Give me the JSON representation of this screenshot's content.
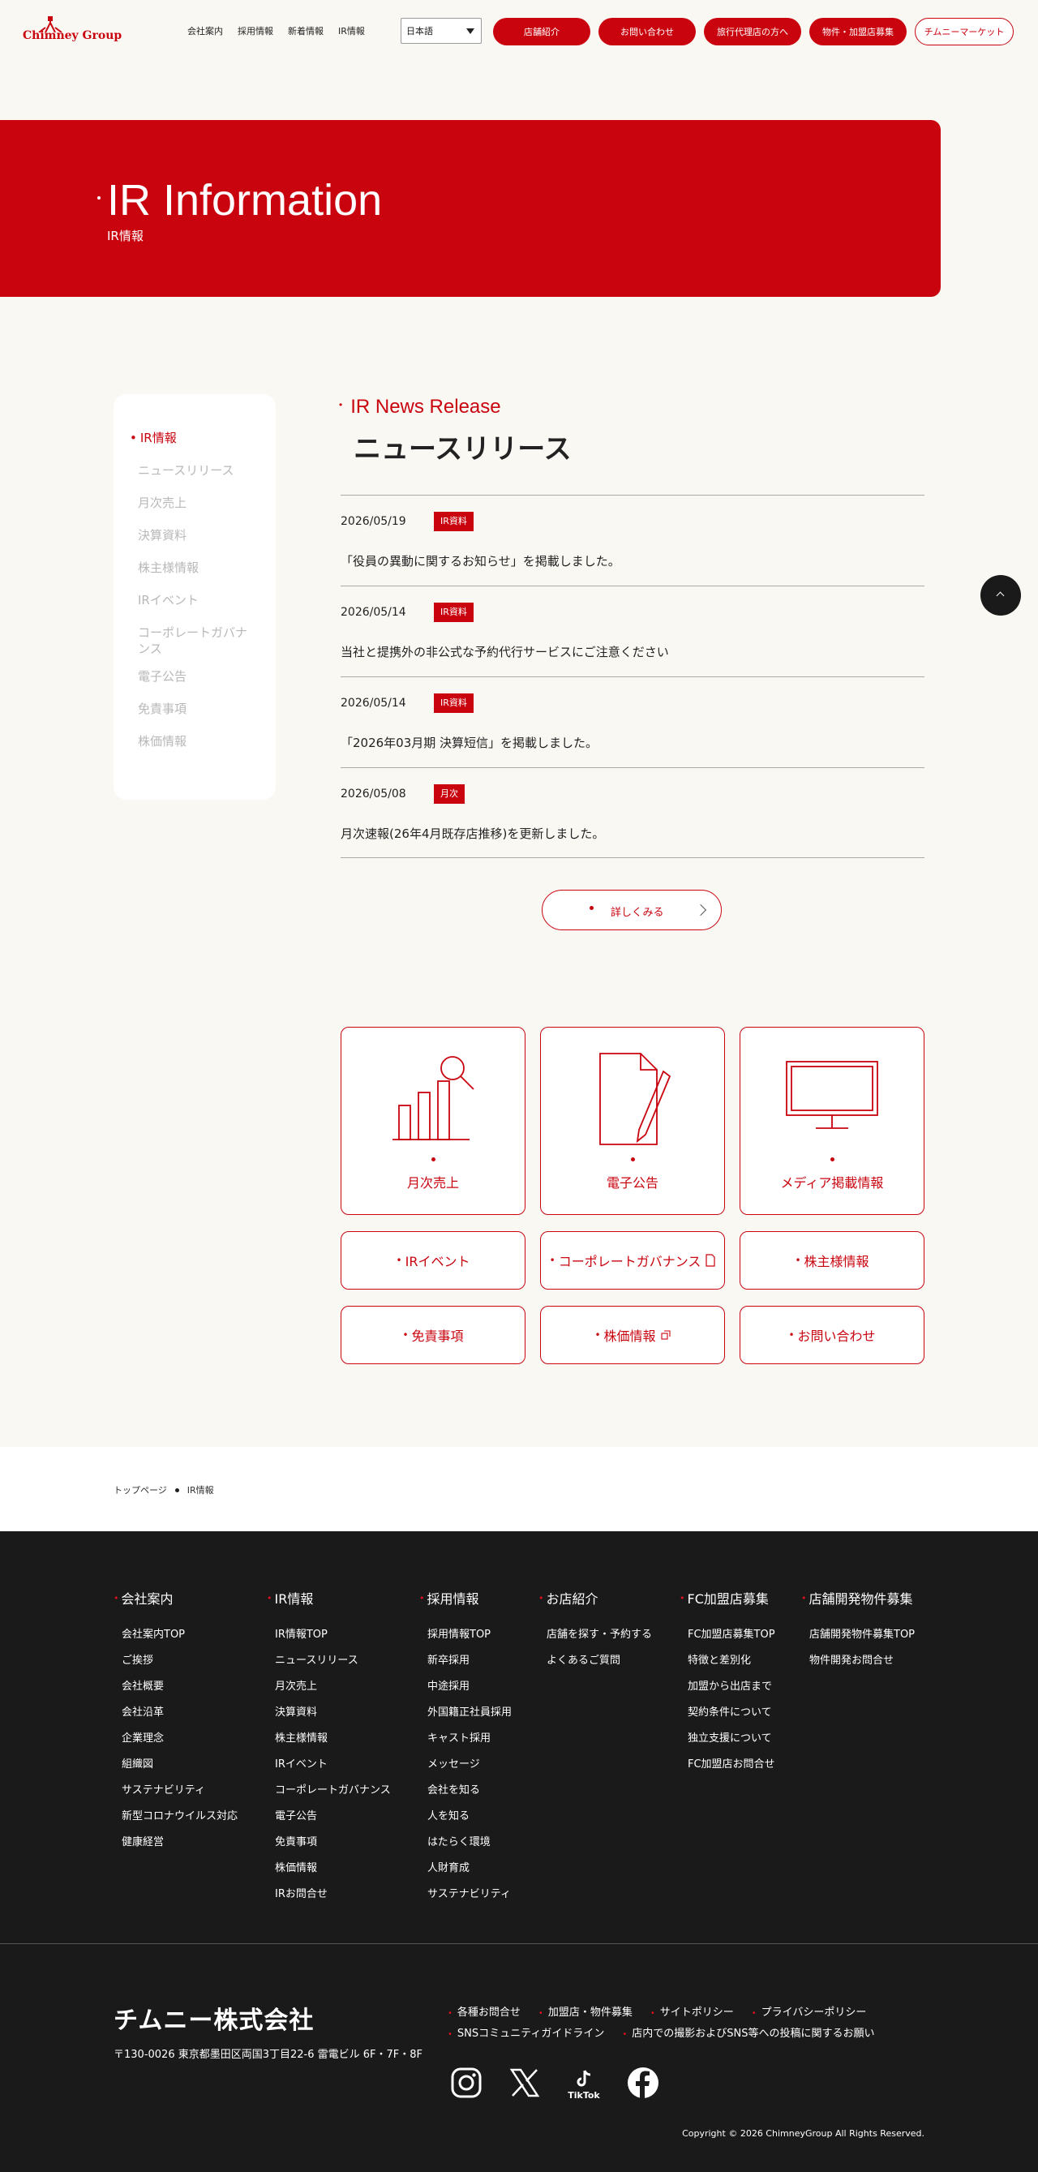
{
  "header": {
    "logo_text": "Chimney Group",
    "nav": [
      "会社案内",
      "採用情報",
      "新着情報",
      "IR情報"
    ],
    "language": "日本語",
    "buttons": [
      "店舗紹介",
      "お問い合わせ",
      "旅行代理店の方へ",
      "物件・加盟店募集"
    ],
    "market_button": "チムニーマーケット"
  },
  "hero": {
    "title": "IR Information",
    "subtitle": "IR情報"
  },
  "sidebar": {
    "items": [
      "IR情報",
      "ニュースリリース",
      "月次売上",
      "決算資料",
      "株主様情報",
      "IRイベント",
      "コーポレートガバナンス",
      "電子公告",
      "免責事項",
      "株価情報"
    ]
  },
  "news": {
    "heading_en": "IR News Release",
    "heading_ja": "ニュースリリース",
    "items": [
      {
        "date": "2026/05/19",
        "tag": "IR資料",
        "text": "「役員の異動に関するお知らせ」を掲載しました。"
      },
      {
        "date": "2026/05/14",
        "tag": "IR資料",
        "text": "当社と提携外の非公式な予約代行サービスにご注意ください"
      },
      {
        "date": "2026/05/14",
        "tag": "IR資料",
        "text": "「2026年03月期 決算短信」を掲載しました。"
      },
      {
        "date": "2026/05/08",
        "tag": "月次",
        "text": "月次速報(26年4月既存店推移)を更新しました。"
      }
    ],
    "more_label": "詳しくみる"
  },
  "cards": {
    "big": [
      "月次売上",
      "電子公告",
      "メディア掲載情報"
    ],
    "small": [
      "IRイベント",
      "コーポレートガバナンス",
      "株主様情報",
      "免責事項",
      "株価情報",
      "お問い合わせ"
    ]
  },
  "breadcrumb": [
    "トップページ",
    "IR情報"
  ],
  "footer": {
    "columns": [
      {
        "head": "会社案内",
        "links": [
          "会社案内TOP",
          "ご挨拶",
          "会社概要",
          "会社沿革",
          "企業理念",
          "組織図",
          "サステナビリティ",
          "新型コロナウイルス対応",
          "健康経営"
        ]
      },
      {
        "head": "IR情報",
        "links": [
          "IR情報TOP",
          "ニュースリリース",
          "月次売上",
          "決算資料",
          "株主様情報",
          "IRイベント",
          "コーポレートガバナンス",
          "電子公告",
          "免責事項",
          "株価情報",
          "IRお問合せ"
        ]
      },
      {
        "head": "採用情報",
        "links": [
          "採用情報TOP",
          "新卒採用",
          "中途採用",
          "外国籍正社員採用",
          "キャスト採用",
          "メッセージ",
          "会社を知る",
          "人を知る",
          "はたらく環境",
          "人財育成",
          "サステナビリティ"
        ]
      },
      {
        "head": "お店紹介",
        "links": [
          "店舗を探す・予約する",
          "よくあるご質問"
        ]
      },
      {
        "head": "FC加盟店募集",
        "links": [
          "FC加盟店募集TOP",
          "特徴と差別化",
          "加盟から出店まで",
          "契約条件について",
          "独立支援について",
          "FC加盟店お問合せ"
        ]
      },
      {
        "head": "店舗開発物件募集",
        "links": [
          "店舗開発物件募集TOP",
          "物件開発お問合せ"
        ]
      }
    ],
    "company_name": "チムニー株式会社",
    "address": "〒130-0026 東京都墨田区両国3丁目22-6 雷電ビル 6F・7F・8F",
    "links_row1": [
      "各種お問合せ",
      "加盟店・物件募集",
      "サイトポリシー",
      "プライバシーポリシー"
    ],
    "links_row2": [
      "SNSコミュニティガイドライン",
      "店内での撮影およびSNS等への投稿に関するお願い"
    ],
    "social": [
      "instagram-icon",
      "x-icon",
      "tiktok-icon",
      "facebook-icon"
    ],
    "tiktok_label": "TikTok",
    "copyright": "Copyright © 2026 ChimneyGroup All Rights Reserved."
  },
  "colors": {
    "brand_red": "#c9040f",
    "footer_bg": "#1a1a1a",
    "page_bg": "#faf8f3"
  }
}
